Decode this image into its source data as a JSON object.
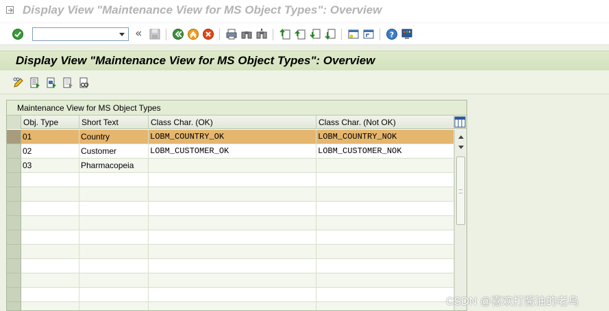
{
  "window": {
    "title": "Display View \"Maintenance View for MS Object Types\": Overview"
  },
  "system_toolbar": {
    "command_field": {
      "value": "",
      "placeholder": ""
    },
    "icons": [
      "enter-check-icon",
      "save-icon",
      "back-icon",
      "exit-icon",
      "cancel-icon",
      "print-icon",
      "find-icon",
      "find-next-icon",
      "first-page-icon",
      "previous-page-icon",
      "next-page-icon",
      "last-page-icon",
      "create-session-icon",
      "shortcut-icon",
      "help-icon",
      "customize-layout-icon"
    ],
    "double_arrow": "«"
  },
  "screen": {
    "title": "Display View \"Maintenance View for MS Object Types\": Overview"
  },
  "app_toolbar": {
    "icons": [
      "display-change-icon",
      "select-all-icon",
      "select-block-icon",
      "deselect-all-icon",
      "other-view-icon"
    ]
  },
  "table": {
    "title": "Maintenance View for MS Object Types",
    "columns": [
      "Obj. Type",
      "Short Text",
      "Class Char. (OK)",
      "Class Char. (Not OK)"
    ],
    "rows": [
      {
        "obj_type": "01",
        "short_text": "Country",
        "class_ok": "LOBM_COUNTRY_OK",
        "class_nok": "LOBM_COUNTRY_NOK",
        "selected": true
      },
      {
        "obj_type": "02",
        "short_text": "Customer",
        "class_ok": "LOBM_CUSTOMER_OK",
        "class_nok": "LOBM_CUSTOMER_NOK",
        "selected": false
      },
      {
        "obj_type": "03",
        "short_text": "Pharmacopeia",
        "class_ok": "",
        "class_nok": "",
        "selected": false
      }
    ],
    "empty_rows": 10
  },
  "colors": {
    "selected_row": "#e5b66e",
    "header_band": "#d3e2bd",
    "background": "#ecf1e4"
  },
  "watermark": "CSDN @喜欢打酱油的老鸟"
}
